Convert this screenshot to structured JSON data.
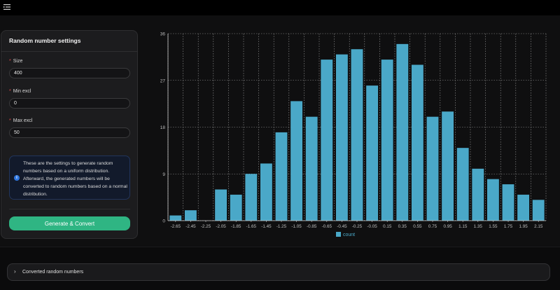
{
  "app": {
    "menu_icon": "hamburger-menu-icon"
  },
  "settings": {
    "title": "Random number settings",
    "fields": [
      {
        "label": "Size",
        "value": "400",
        "required": true
      },
      {
        "label": "Min excl",
        "value": "0",
        "required": true
      },
      {
        "label": "Max excl",
        "value": "50",
        "required": true
      }
    ],
    "info_icon": "info-icon",
    "info_text": "These are the settings to generate random numbers based on a uniform distribution. Afterward, the generated numbers will be converted to random numbers based on a normal distribution.",
    "generate_label": "Generate & Convert",
    "colors": {
      "accent": "#2fb583",
      "info_bg": "#121a2b",
      "info_border": "#22355c",
      "required": "#e34b4b"
    }
  },
  "accordion": {
    "label": "Converted random numbers",
    "chevron_icon": "chevron-right-icon"
  },
  "chart_data": {
    "type": "bar",
    "categories": [
      "-2.65",
      "-2.45",
      "-2.25",
      "-2.05",
      "-1.85",
      "-1.65",
      "-1.45",
      "-1.25",
      "-1.05",
      "-0.85",
      "-0.65",
      "-0.45",
      "-0.25",
      "-0.05",
      "0.15",
      "0.35",
      "0.55",
      "0.75",
      "0.95",
      "1.15",
      "1.35",
      "1.55",
      "1.75",
      "1.95",
      "2.15"
    ],
    "series": [
      {
        "name": "count",
        "values": [
          1,
          2,
          0,
          6,
          5,
          9,
          11,
          17,
          23,
          20,
          31,
          32,
          33,
          26,
          31,
          34,
          30,
          20,
          21,
          14,
          10,
          8,
          7,
          5,
          4
        ]
      }
    ],
    "yticks": [
      "0",
      "9",
      "18",
      "27",
      "36"
    ],
    "ylim": [
      0,
      36
    ],
    "grid": true,
    "legend": "bottom-center",
    "bar_color": "#4aa8c8"
  }
}
